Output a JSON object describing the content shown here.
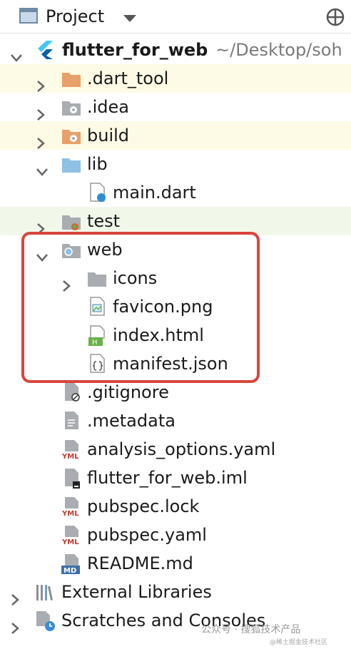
{
  "header": {
    "title": "Project",
    "view_icon": "panel-icon",
    "dropdown_icon": "caret-down-icon",
    "locate_icon": "crosshair-icon"
  },
  "tree": {
    "root": {
      "name": "flutter_for_web",
      "path": "~/Desktop/soh"
    },
    "dart_tool": ".dart_tool",
    "idea": ".idea",
    "build": "build",
    "lib": "lib",
    "main_dart": "main.dart",
    "test": "test",
    "web": "web",
    "icons": "icons",
    "favicon": "favicon.png",
    "index_html": "index.html",
    "manifest": "manifest.json",
    "gitignore": ".gitignore",
    "metadata": ".metadata",
    "analysis_options": "analysis_options.yaml",
    "iml": "flutter_for_web.iml",
    "pubspec_lock": "pubspec.lock",
    "pubspec_yaml": "pubspec.yaml",
    "readme": "README.md",
    "external_libraries": "External Libraries",
    "scratches": "Scratches and Consoles"
  },
  "badges": {
    "yml": "YML",
    "md": "MD",
    "h": "H"
  },
  "watermark": {
    "main": "公众号 · 搜狐技术产品",
    "sub": "@稀土掘金技术社区"
  },
  "colors": {
    "folder_blue": "#8fc0e6",
    "folder_orange": "#e8a06a",
    "folder_gray": "#a9adb2",
    "highlight_border": "#d8453c",
    "row_yellow": "#fdfbe6",
    "row_green": "#f1f8ea"
  }
}
